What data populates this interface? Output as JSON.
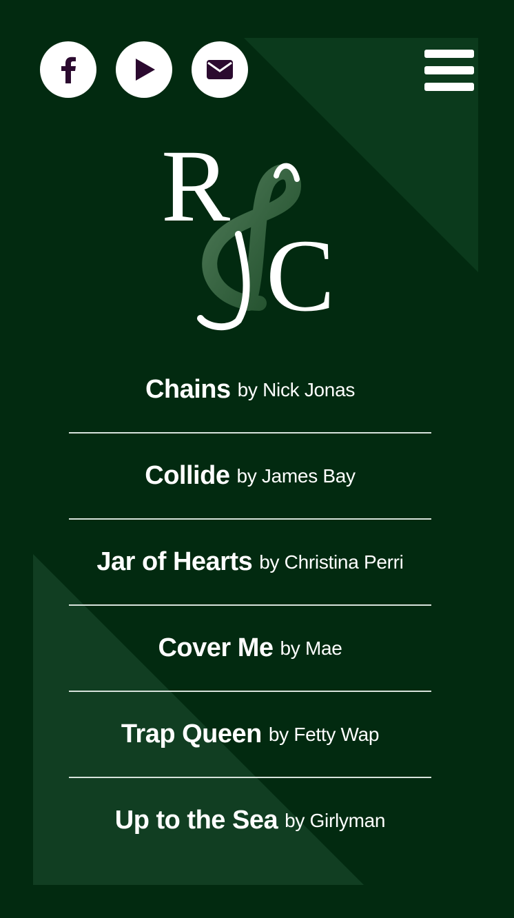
{
  "colors": {
    "background": "#022a10",
    "decor": "#0f3f20",
    "button": "#ffffff",
    "icon": "#2b0a2f"
  },
  "social": [
    {
      "name": "facebook",
      "icon": "facebook-icon"
    },
    {
      "name": "youtube",
      "icon": "play-icon"
    },
    {
      "name": "email",
      "icon": "envelope-icon"
    }
  ],
  "menu": {
    "icon": "hamburger-menu-icon"
  },
  "logo": {
    "text": "RfJC"
  },
  "songs": [
    {
      "title": "Chains",
      "by": "by Nick Jonas"
    },
    {
      "title": "Collide",
      "by": "by James Bay"
    },
    {
      "title": "Jar of Hearts",
      "by": "by Christina Perri"
    },
    {
      "title": "Cover Me",
      "by": "by Mae"
    },
    {
      "title": "Trap Queen",
      "by": "by Fetty Wap"
    },
    {
      "title": "Up to the Sea",
      "by": "by Girlyman"
    }
  ]
}
